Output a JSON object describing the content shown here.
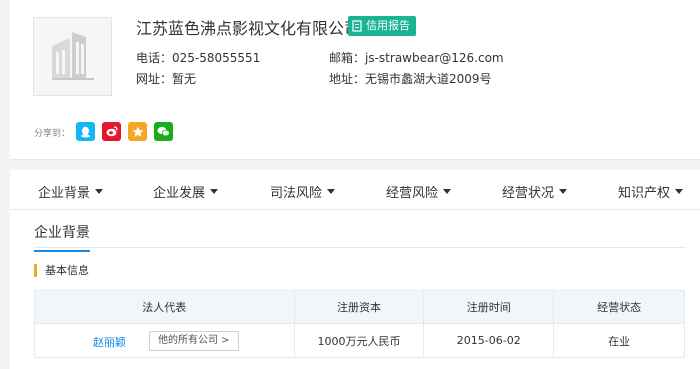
{
  "company": {
    "name": "江苏蓝色沸点影视文化有限公司",
    "report_badge": "信用报告"
  },
  "contact": {
    "phone_label": "电话：",
    "phone": "025-58055551",
    "email_label": "邮箱：",
    "email": "js-strawbear@126.com",
    "website_label": "网址：",
    "website": "暂无",
    "address_label": "地址：",
    "address": "无锡市蠡湖大道2009号"
  },
  "share": {
    "label": "分享到：",
    "icons": [
      "qq-icon",
      "weibo-icon",
      "qzone-icon",
      "wechat-icon"
    ],
    "colors": [
      "#12b7f5",
      "#e6162d",
      "#f5a623",
      "#1aad19"
    ]
  },
  "nav": {
    "items": [
      "企业背景",
      "企业发展",
      "司法风险",
      "经营风险",
      "经营状况",
      "知识产权"
    ]
  },
  "section": {
    "title": "企业背景",
    "subtitle": "基本信息"
  },
  "basic_table": {
    "headers": [
      "法人代表",
      "注册资本",
      "注册时间",
      "经营状态"
    ],
    "row": {
      "legal_rep": "赵丽颖",
      "all_companies_button": "他的所有公司 >",
      "capital": "1000万元人民币",
      "date": "2015-06-02",
      "status": "在业"
    }
  },
  "colors": {
    "accent": "#128bed",
    "badge": "#1ab394",
    "subtitle_bar": "#f5a623"
  }
}
